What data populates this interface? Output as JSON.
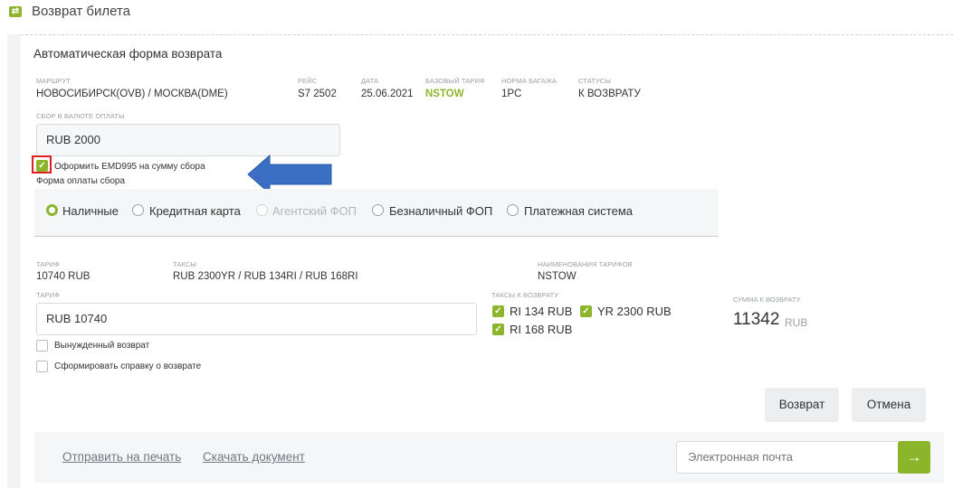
{
  "header": {
    "title": "Возврат билета",
    "icon": "ticket-icon"
  },
  "panel": {
    "title": "Автоматическая форма возврата"
  },
  "route": {
    "route_label": "МАРШРУТ",
    "route_value": "НОВОСИБИРСК(OVB) / МОСКВА(DME)",
    "flight_label": "РЕЙС",
    "flight_value": "S7 2502",
    "date_label": "ДАТА",
    "date_value": "25.06.2021",
    "base_fare_label": "БАЗОВЫЙ ТАРИФ",
    "base_fare_value": "NSTOW",
    "baggage_label": "НОРМА БАГАЖА",
    "baggage_value": "1PC",
    "status_label": "СТАТУСЫ",
    "status_value": "К ВОЗВРАТУ"
  },
  "fee": {
    "label": "СБОР В ВАЛЮТЕ ОПЛАТЫ",
    "value": "RUB 2000",
    "emd_checkbox_label": "Оформить EMD995 на сумму сбора",
    "emd_checked": true,
    "payment_form_label": "Форма оплаты сбора"
  },
  "payment_options": [
    {
      "label": "Наличные",
      "state": "selected"
    },
    {
      "label": "Кредитная карта",
      "state": "normal"
    },
    {
      "label": "Агентский ФОП",
      "state": "disabled"
    },
    {
      "label": "Безналичный ФОП",
      "state": "normal"
    },
    {
      "label": "Платежная система",
      "state": "normal"
    }
  ],
  "fare": {
    "tariff_label": "ТАРИФ",
    "tariff_value": "10740 RUB",
    "taxes_label": "ТАКСЫ",
    "taxes_value": "RUB 2300YR / RUB 134RI / RUB 168RI",
    "fare_names_label": "НАИМЕНОВАНИЯ ТАРИФОВ",
    "fare_names_value": "NSTOW",
    "tariff_input_label": "ТАРИФ",
    "tariff_input_value": "RUB 10740",
    "refund_taxes_label": "ТАКСЫ К ВОЗВРАТУ",
    "refund_taxes": [
      "RI 134 RUB",
      "YR 2300 RUB",
      "RI 168 RUB"
    ],
    "forced_refund_label": "Вынужденный  возврат",
    "certificate_label": "Сформировать справку о возврате"
  },
  "summary": {
    "label": "СУММА К ВОЗВРАТУ",
    "amount": "11342",
    "currency": "RUB"
  },
  "buttons": {
    "refund": "Возврат",
    "cancel": "Отмена"
  },
  "footer": {
    "print_link": "Отправить на печать",
    "download_link": "Скачать документ",
    "email_placeholder": "Электронная почта",
    "send_icon": "arrow-right-icon"
  },
  "colors": {
    "accent": "#8db52c",
    "highlight": "#e02020",
    "arrow": "#3a6fc4"
  }
}
